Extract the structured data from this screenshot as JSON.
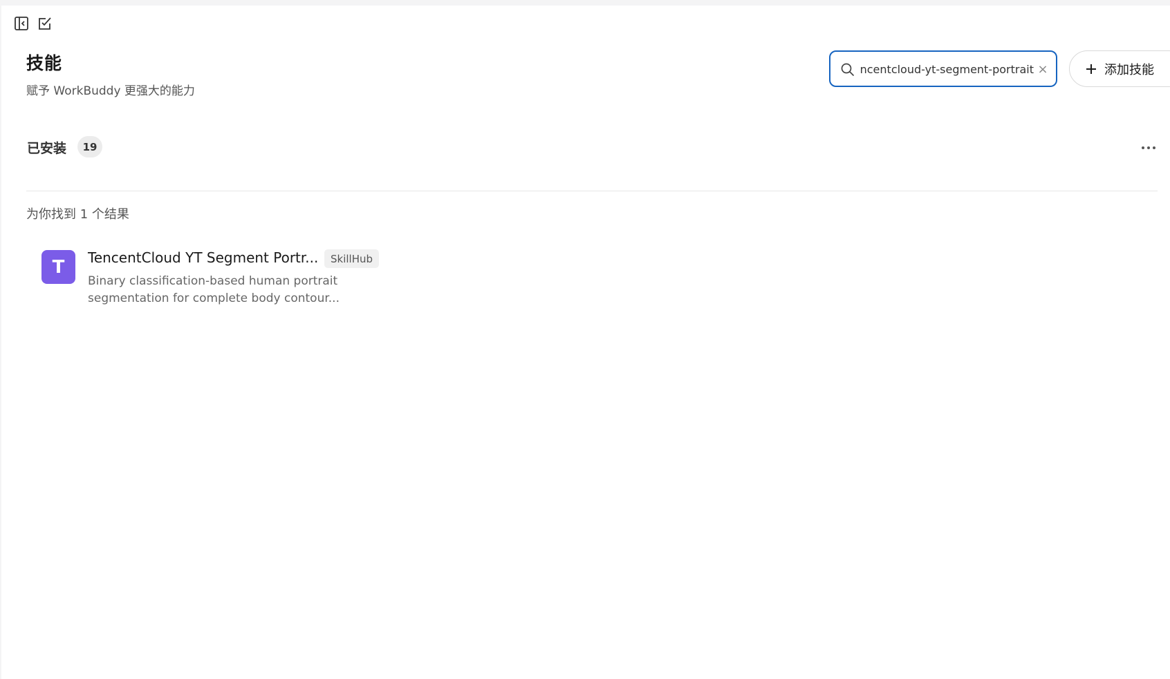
{
  "toolbar": {
    "sidebar_toggle_icon": "sidebar-collapse-icon",
    "new_task_icon": "edit-checkbox-icon"
  },
  "header": {
    "title": "技能",
    "subtitle": "赋予 WorkBuddy 更强大的能力"
  },
  "search": {
    "value": "tencentcloud-yt-segment-portrait",
    "placeholder": "",
    "clear_icon": "×"
  },
  "add_skill": {
    "label": "添加技能"
  },
  "installed": {
    "label": "已安装",
    "count": "19"
  },
  "results": {
    "summary": "为你找到 1 个结果",
    "items": [
      {
        "avatar_letter": "T",
        "name": "TencentCloud YT Segment Portr...",
        "source": "SkillHub",
        "description_line1": "Binary classification-based human portrait",
        "description_line2": "segmentation for complete body contour..."
      }
    ]
  },
  "colors": {
    "accent": "#1664c0",
    "avatar": "#7b5ce8"
  }
}
